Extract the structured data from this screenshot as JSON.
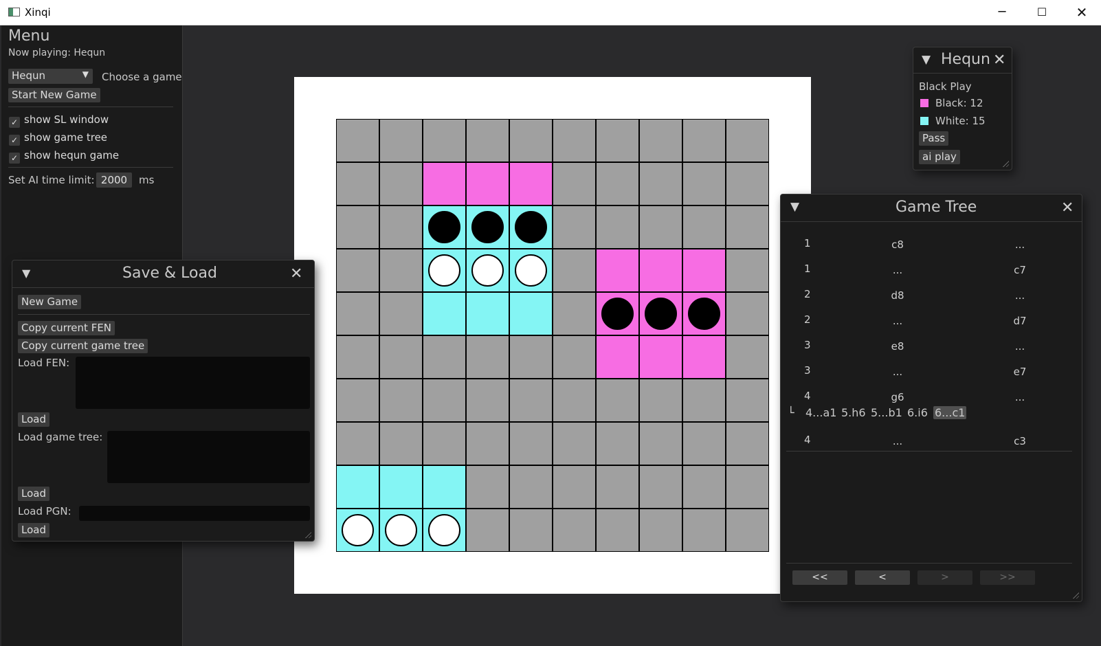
{
  "window": {
    "title": "Xinqi",
    "controls": {
      "minimize": "─",
      "maximize": "☐",
      "close": "✕"
    }
  },
  "menu": {
    "title": "Menu",
    "now_playing": "Now playing: Hequn",
    "game_select": {
      "value": "Hequn",
      "label": "Choose a game"
    },
    "start_new_game": "Start New Game",
    "checkboxes": [
      {
        "label": "show SL window",
        "checked": true
      },
      {
        "label": "show game tree",
        "checked": true
      },
      {
        "label": "show hequn game",
        "checked": true
      }
    ],
    "ai_time": {
      "label": "Set AI time limit:",
      "value": "2000",
      "unit": "ms"
    }
  },
  "board": {
    "size": 10,
    "colors": {
      "background": "#ffffff",
      "empty": "#a0a0a0",
      "magenta": "#f76de3",
      "cyan": "#84f5f4",
      "line": "#000000"
    },
    "rows": [
      "..........",
      "..MMM.....",
      "..ccc.....",
      "..CCC.MMM.",
      "..CCC.mmm.",
      "......MMM.",
      "..........",
      "..........",
      "CCC.......",
      "ccc......."
    ],
    "legend": {
      ".": "empty",
      "M": "magenta",
      "C": "cyan",
      "m": "magenta+black stone",
      "c": "cyan+stone per row",
      "w": "white stone"
    },
    "stones": [
      {
        "row": 2,
        "col": 2,
        "color": "black"
      },
      {
        "row": 2,
        "col": 3,
        "color": "black"
      },
      {
        "row": 2,
        "col": 4,
        "color": "black"
      },
      {
        "row": 3,
        "col": 2,
        "color": "white"
      },
      {
        "row": 3,
        "col": 3,
        "color": "white"
      },
      {
        "row": 3,
        "col": 4,
        "color": "white"
      },
      {
        "row": 4,
        "col": 6,
        "color": "black"
      },
      {
        "row": 4,
        "col": 7,
        "color": "black"
      },
      {
        "row": 4,
        "col": 8,
        "color": "black"
      },
      {
        "row": 9,
        "col": 0,
        "color": "white"
      },
      {
        "row": 9,
        "col": 1,
        "color": "white"
      },
      {
        "row": 9,
        "col": 2,
        "color": "white"
      }
    ]
  },
  "save_load": {
    "title": "Save & Load",
    "new_game": "New Game",
    "copy_fen": "Copy current FEN",
    "copy_tree": "Copy current game tree",
    "load_fen_label": "Load FEN:",
    "load_tree_label": "Load game tree:",
    "load_pgn_label": "Load PGN:",
    "load_button": "Load"
  },
  "hequn": {
    "title": "Hequn",
    "status": "Black Play",
    "black_count": "Black: 12",
    "white_count": "White: 15",
    "black_color": "#f76de3",
    "white_color": "#84f5f4",
    "pass": "Pass",
    "ai_play": "ai play"
  },
  "game_tree": {
    "title": "Game Tree",
    "rows": [
      {
        "num": "1",
        "white": "c8",
        "black": "..."
      },
      {
        "num": "1",
        "white": "...",
        "black": "c7"
      },
      {
        "num": "2",
        "white": "d8",
        "black": "..."
      },
      {
        "num": "2",
        "white": "...",
        "black": "d7"
      },
      {
        "num": "3",
        "white": "e8",
        "black": "..."
      },
      {
        "num": "3",
        "white": "...",
        "black": "e7"
      },
      {
        "num": "4",
        "white": "g6",
        "black": "..."
      }
    ],
    "variation": {
      "branch": "└",
      "moves": [
        "4...a1",
        "5.h6",
        "5...b1",
        "6.i6",
        "6...c1"
      ],
      "selected_index": 4
    },
    "last_row": {
      "num": "4",
      "white": "...",
      "black": "c3"
    },
    "nav": {
      "first": "<<",
      "prev": "<",
      "next": ">",
      "last": ">>"
    }
  }
}
